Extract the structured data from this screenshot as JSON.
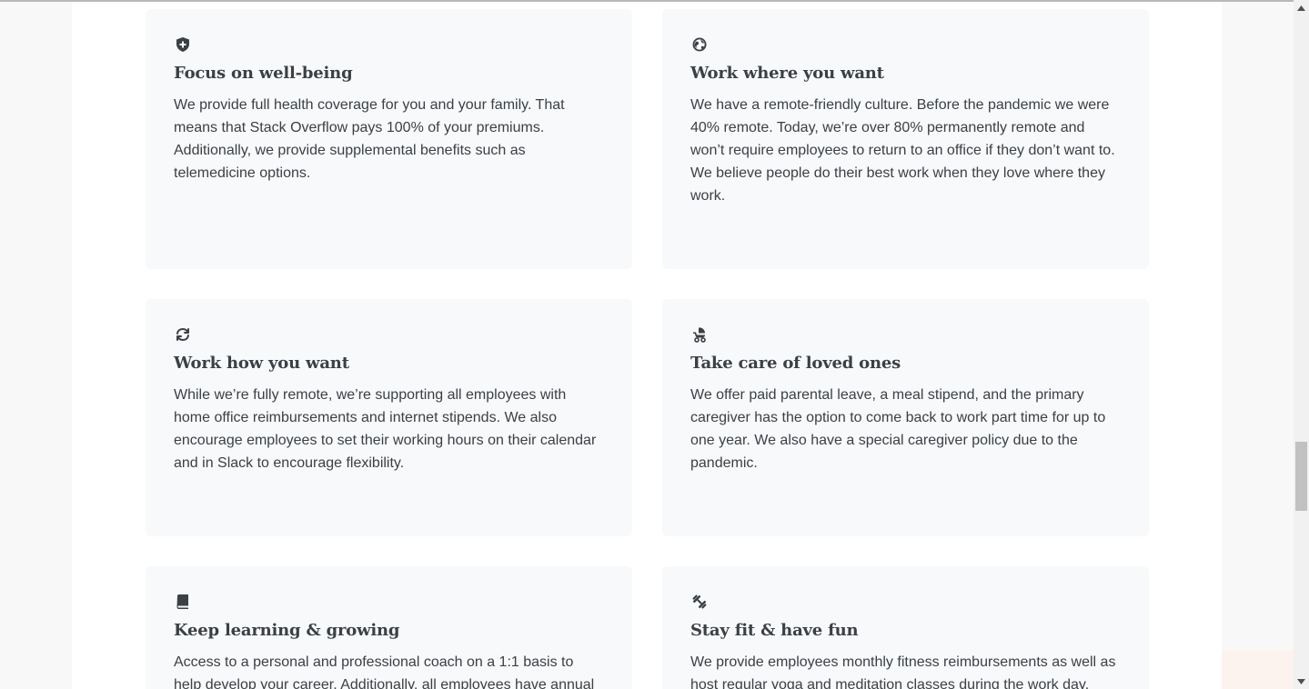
{
  "cards": [
    {
      "icon": "shield-plus-icon",
      "title": "Focus on well-being",
      "body": "We provide full health coverage for you and your family. That means that Stack Overflow pays 100% of your premiums. Additionally, we provide supplemental benefits such as telemedicine options."
    },
    {
      "icon": "globe-icon",
      "title": "Work where you want",
      "body": "We have a remote-friendly culture. Before the pandemic we were 40% remote. Today, we’re over 80% permanently remote and won’t require employees to return to an office if they don’t want to. We believe people do their best work when they love where they work."
    },
    {
      "icon": "refresh-arrows-icon",
      "title": "Work how you want",
      "body": "While we’re fully remote, we’re supporting all employees with home office reimbursements and internet stipends. We also encourage employees to set their working hours on their calendar and in Slack to encourage flexibility."
    },
    {
      "icon": "baby-stroller-icon",
      "title": "Take care of loved ones",
      "body": "We offer paid parental leave, a meal stipend, and the primary caregiver has the option to come back to work part time for up to one year. We also have a special caregiver policy due to the pandemic."
    },
    {
      "icon": "book-icon",
      "title": "Keep learning & growing",
      "body": "Access to a personal and professional coach on a 1:1 basis to help develop your career. Additionally, all employees have annual"
    },
    {
      "icon": "dumbbell-icon",
      "title": "Stay fit & have fun",
      "body": "We provide employees monthly fitness reimbursements as well as host regular yoga and meditation classes during the work day."
    }
  ],
  "colors": {
    "page_background": "#f8f8f9",
    "content_background": "#ffffff",
    "card_background": "#f8f9fa",
    "text": "#3b4045",
    "icon": "#3b4045"
  },
  "scrollbar": {
    "position_fraction": 0.64
  }
}
